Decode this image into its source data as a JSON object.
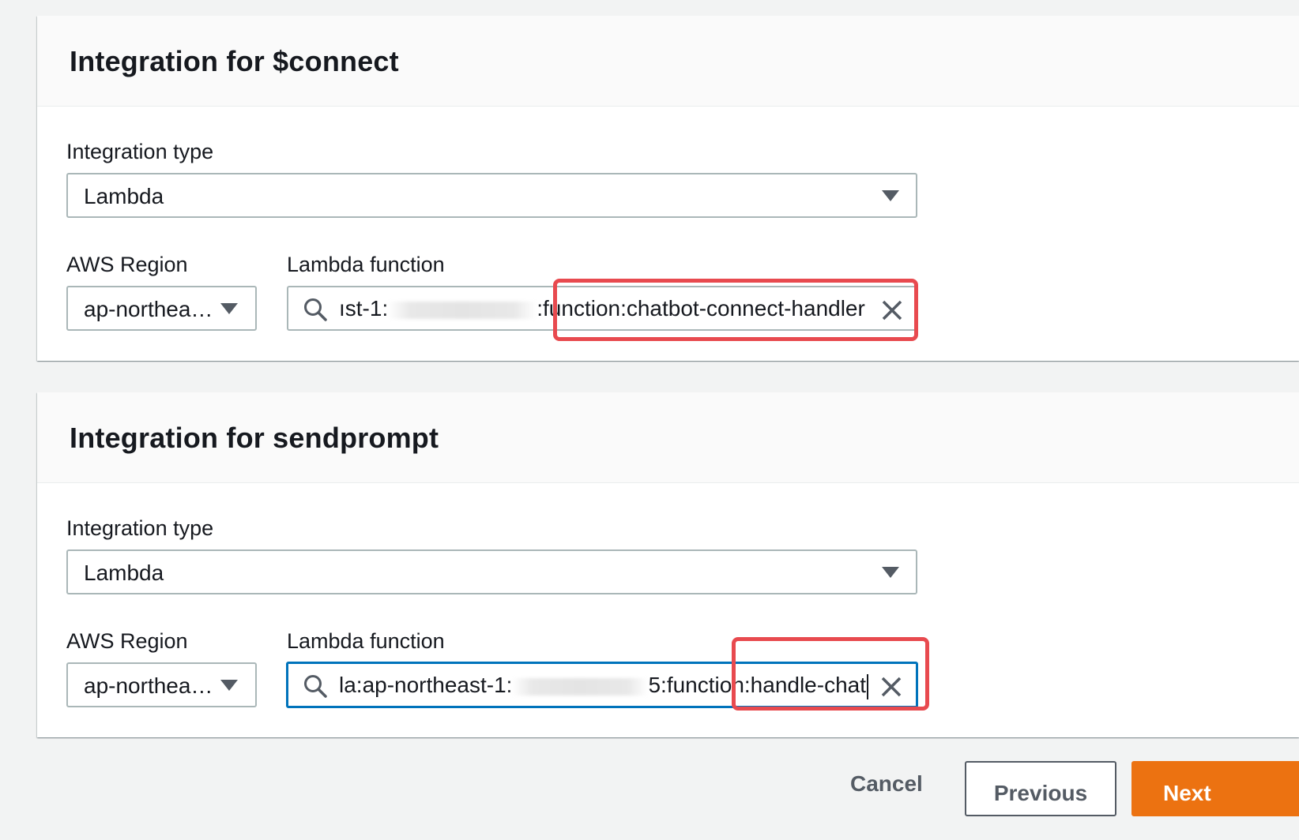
{
  "sections": [
    {
      "title": "Integration for $connect",
      "integration_type_label": "Integration type",
      "integration_type_value": "Lambda",
      "region_label": "AWS Region",
      "region_value": "ap-northea…",
      "lambda_label": "Lambda function",
      "lambda_value_prefix": "ıst-1:",
      "lambda_value_suffix": ":function:chatbot-connect-handler",
      "focused": false,
      "highlighted": true
    },
    {
      "title": "Integration for sendprompt",
      "integration_type_label": "Integration type",
      "integration_type_value": "Lambda",
      "region_label": "AWS Region",
      "region_value": "ap-northea…",
      "lambda_label": "Lambda function",
      "lambda_value_prefix": "la:ap-northeast-1:",
      "lambda_value_suffix": "5:function:handle-chat",
      "focused": true,
      "highlighted": true
    }
  ],
  "footer": {
    "cancel_label": "Cancel",
    "previous_label": "Previous",
    "next_label": "Next"
  },
  "icons": {
    "search": "search-icon",
    "clear": "close-icon",
    "dropdown": "caret-down-icon"
  },
  "colors": {
    "primary": "#ec7211",
    "focus": "#0073bb",
    "annotation": "#e84a4f"
  }
}
